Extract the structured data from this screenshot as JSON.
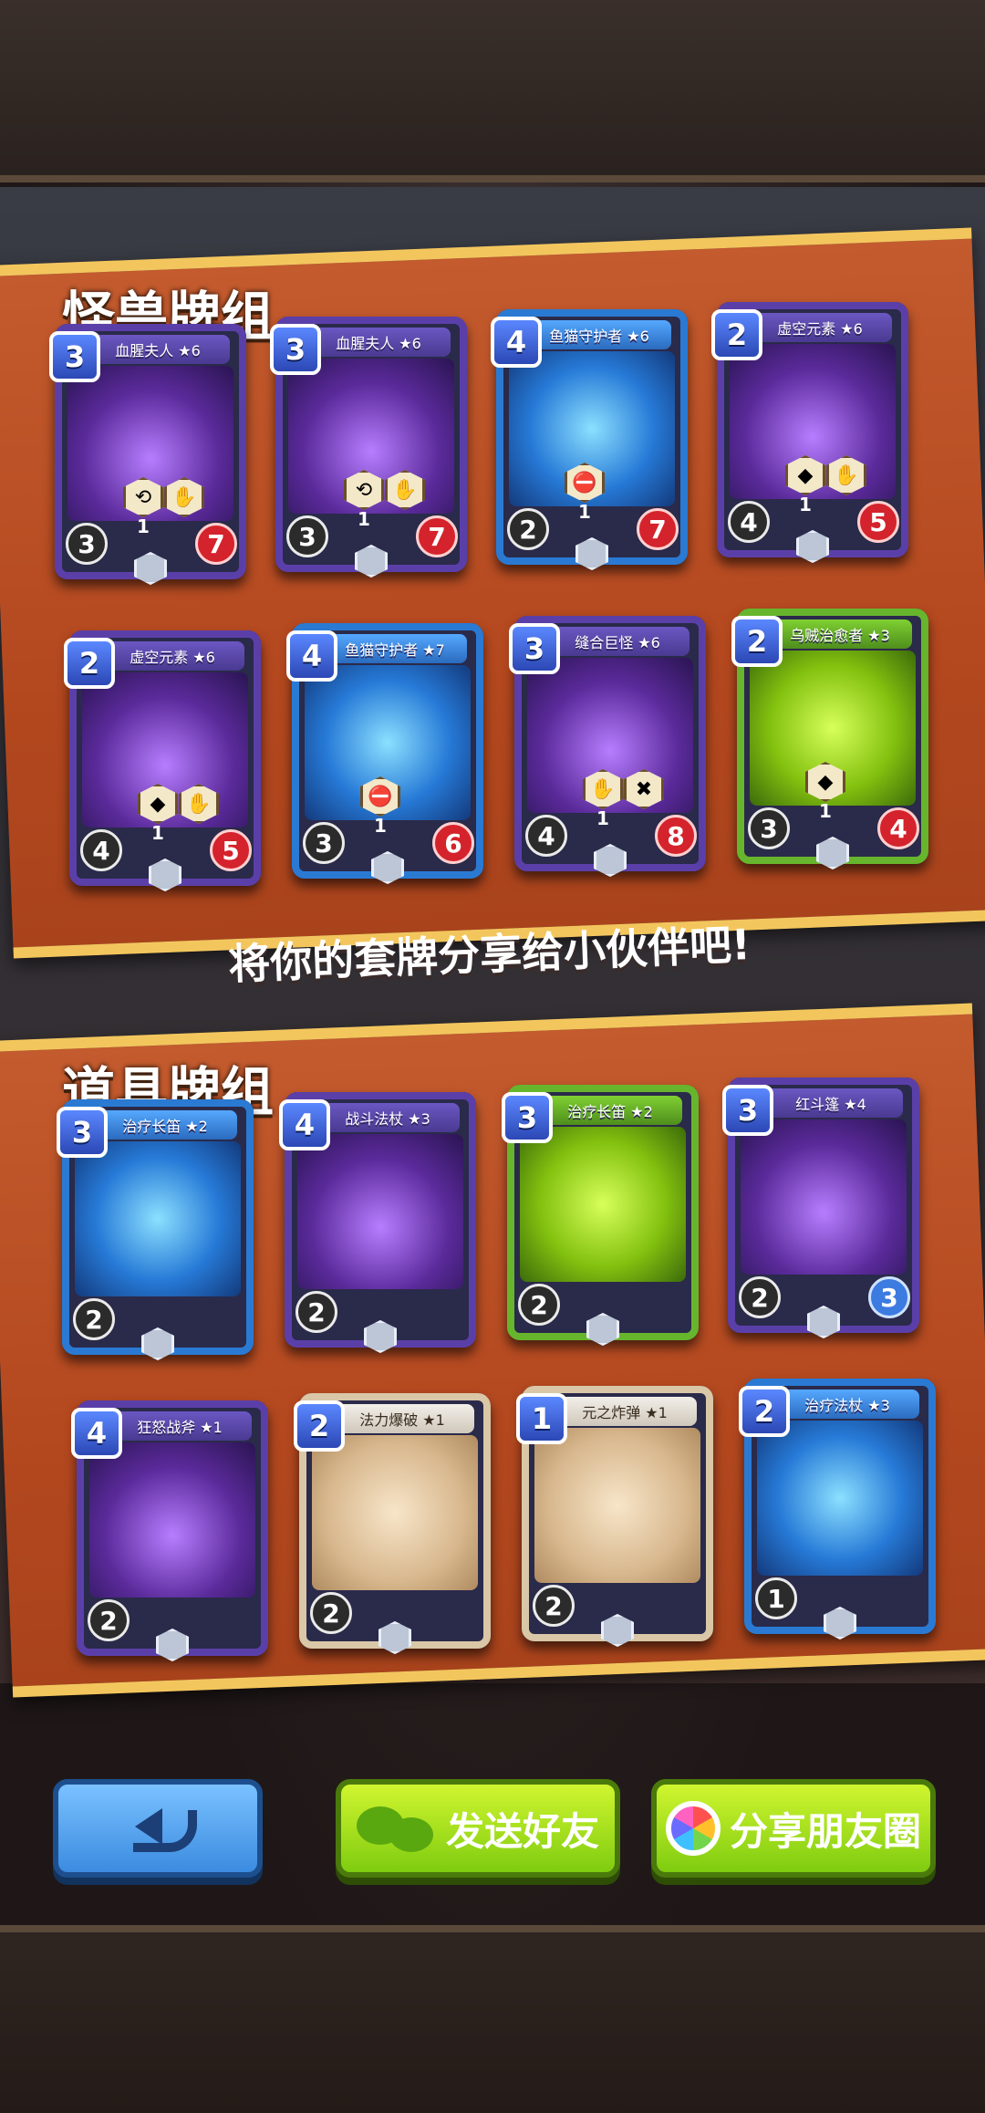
{
  "titles": {
    "monster_deck": "怪兽牌组",
    "item_deck": "道具牌组",
    "share_prompt": "将你的套牌分享给小伙伴吧!"
  },
  "monster_cards": [
    {
      "name": "血腥夫人 ★6",
      "cost": "3",
      "atk": "3",
      "hp": "7",
      "theme": "purple",
      "ability_num": "1"
    },
    {
      "name": "血腥夫人 ★6",
      "cost": "3",
      "atk": "3",
      "hp": "7",
      "theme": "purple",
      "ability_num": "1"
    },
    {
      "name": "鱼猫守护者 ★6",
      "cost": "4",
      "atk": "2",
      "hp": "7",
      "theme": "blue",
      "ability_num": "1"
    },
    {
      "name": "虚空元素 ★6",
      "cost": "2",
      "atk": "4",
      "hp": "5",
      "theme": "purple",
      "ability_num": "1"
    },
    {
      "name": "虚空元素 ★6",
      "cost": "2",
      "atk": "4",
      "hp": "5",
      "theme": "purple",
      "ability_num": "1"
    },
    {
      "name": "鱼猫守护者 ★7",
      "cost": "4",
      "atk": "3",
      "hp": "6",
      "theme": "blue",
      "ability_num": "1"
    },
    {
      "name": "缝合巨怪 ★6",
      "cost": "3",
      "atk": "4",
      "hp": "8",
      "theme": "purple",
      "ability_num": "1"
    },
    {
      "name": "乌贼治愈者 ★3",
      "cost": "2",
      "atk": "3",
      "hp": "4",
      "theme": "green",
      "ability_num": "1"
    }
  ],
  "item_cards": [
    {
      "name": "治疗长笛 ★2",
      "cost": "3",
      "bottom": "2",
      "theme": "blue"
    },
    {
      "name": "战斗法杖 ★3",
      "cost": "4",
      "bottom": "2",
      "theme": "purple"
    },
    {
      "name": "治疗长笛 ★2",
      "cost": "3",
      "bottom": "2",
      "theme": "green"
    },
    {
      "name": "红斗篷 ★4",
      "cost": "3",
      "bottom": "2",
      "theme": "purple",
      "right": "3"
    },
    {
      "name": "狂怒战斧 ★1",
      "cost": "4",
      "bottom": "2",
      "theme": "purple"
    },
    {
      "name": "法力爆破 ★1",
      "cost": "2",
      "bottom": "2",
      "theme": "beige"
    },
    {
      "name": "元之炸弹 ★1",
      "cost": "1",
      "bottom": "2",
      "theme": "beige"
    },
    {
      "name": "治疗法杖 ★3",
      "cost": "2",
      "bottom": "1",
      "theme": "blue"
    }
  ],
  "buttons": {
    "back": "back-arrow-icon",
    "send_friend": "发送好友",
    "share_moments": "分享朋友圈"
  }
}
